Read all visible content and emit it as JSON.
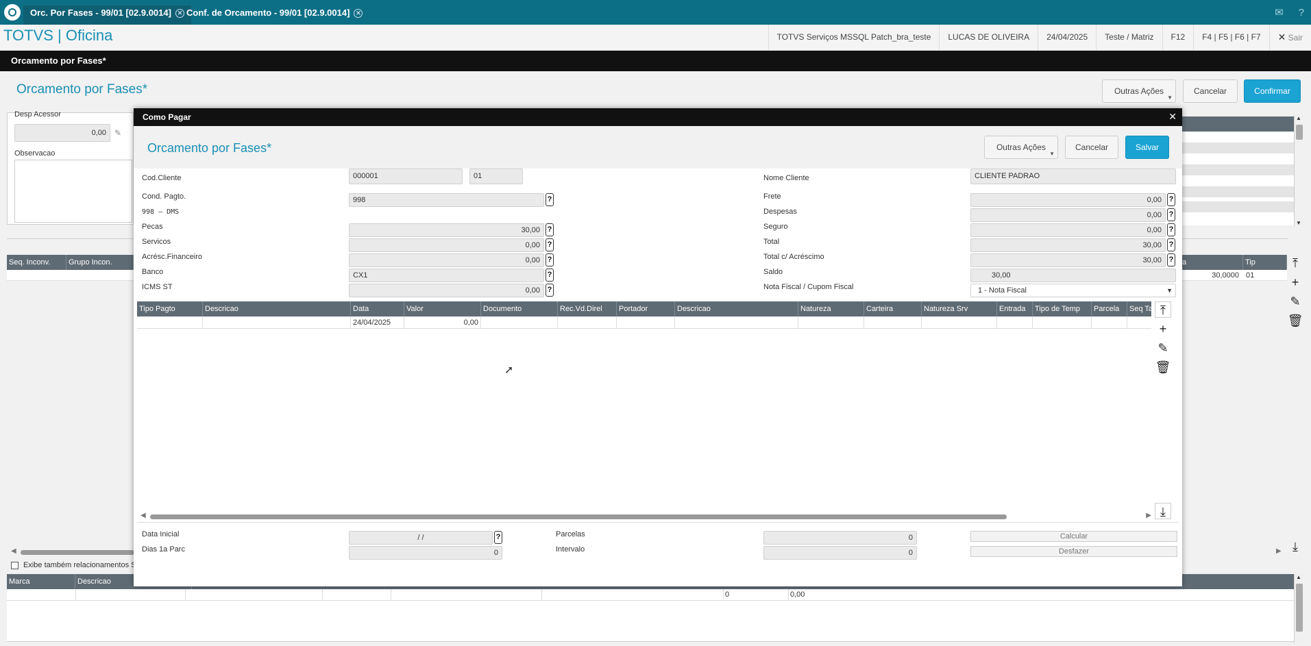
{
  "tabs": [
    {
      "label": "Orc. Por Fases - 99/01 [02.9.0014]"
    },
    {
      "label": "Conf. de Orcamento - 99/01 [02.9.0014]"
    }
  ],
  "header": {
    "brand": "TOTVS | Oficina",
    "env": "TOTVS Serviços MSSQL Patch_bra_teste",
    "user": "LUCAS DE OLIVEIRA",
    "date": "24/04/2025",
    "company": "Teste / Matriz",
    "shortcut1": "F12",
    "shortcut2": "F4 | F5 | F6 | F7",
    "exit": "Sair"
  },
  "window": {
    "title": "Orcamento por Fases*"
  },
  "background": {
    "title": "Orcamento por Fases*",
    "outras_acoes": "Outras Ações",
    "cancelar": "Cancelar",
    "confirmar": "Confirmar",
    "desp_acessor_label": "Desp Acessor",
    "desp_acessor_value": "0,00",
    "observacao_label": "Observacao",
    "right_value_0": "0",
    "grid1_headers": [
      "Seq. Inconv.",
      "Grupo Incon."
    ],
    "grid1_right_headers": [
      "a",
      "Tip Operaca"
    ],
    "grid1_row_value": "30,0000",
    "grid1_row_tipop": "01",
    "checkbox_label": "Exibe também relacionamentos S",
    "grid2_headers": [
      "Marca",
      "Descricao"
    ],
    "grid2_row_qty": "0",
    "grid2_row_value": "0,00"
  },
  "modal": {
    "title": "Como Pagar",
    "heading": "Orcamento por Fases*",
    "outras_acoes": "Outras Ações",
    "cancelar": "Cancelar",
    "salvar": "Salvar",
    "cod_cliente_label": "Cod.Cliente",
    "cod_cliente": "000001",
    "loja": "01",
    "nome_cliente_label": "Nome Cliente",
    "nome_cliente": "CLIENTE PADRAO",
    "cond_pagto_label": "Cond. Pagto.",
    "cond_pagto": "998",
    "cond_desc": "998 – DMS",
    "frete_label": "Frete",
    "frete": "0,00",
    "despesas_label": "Despesas",
    "despesas": "0,00",
    "pecas_label": "Pecas",
    "pecas": "30,00",
    "seguro_label": "Seguro",
    "seguro": "0,00",
    "servicos_label": "Servicos",
    "servicos": "0,00",
    "total_label": "Total",
    "total": "30,00",
    "acresc_label": "Acrésc.Financeiro",
    "acresc": "0,00",
    "total_acresc_label": "Total c/ Acréscimo",
    "total_acresc": "30,00",
    "banco_label": "Banco",
    "banco": "CX1",
    "saldo_label": "Saldo",
    "saldo": "30,00",
    "icms_label": "ICMS ST",
    "icms": "0,00",
    "nota_label": "Nota Fiscal / Cupom Fiscal",
    "nota_value": "1 - Nota Fiscal",
    "grid_headers": [
      "Tipo Pagto",
      "Descricao",
      "Data",
      "Valor",
      "Documento",
      "Rec.Vd.Direl",
      "Portador",
      "Descricao",
      "Natureza",
      "Carteira",
      "Natureza Srv",
      "Entrada",
      "Tipo de Temp",
      "Parcela",
      "Seq Ta"
    ],
    "row_data": "24/04/2025",
    "row_valor": "0,00",
    "data_inicial_label": "Data Inicial",
    "data_inicial": "/ /",
    "dias_label": "Dias 1a Parc",
    "dias": "0",
    "parcelas_label": "Parcelas",
    "parcelas": "0",
    "intervalo_label": "Intervalo",
    "intervalo": "0",
    "calcular": "Calcular",
    "desfazer": "Desfazer"
  }
}
